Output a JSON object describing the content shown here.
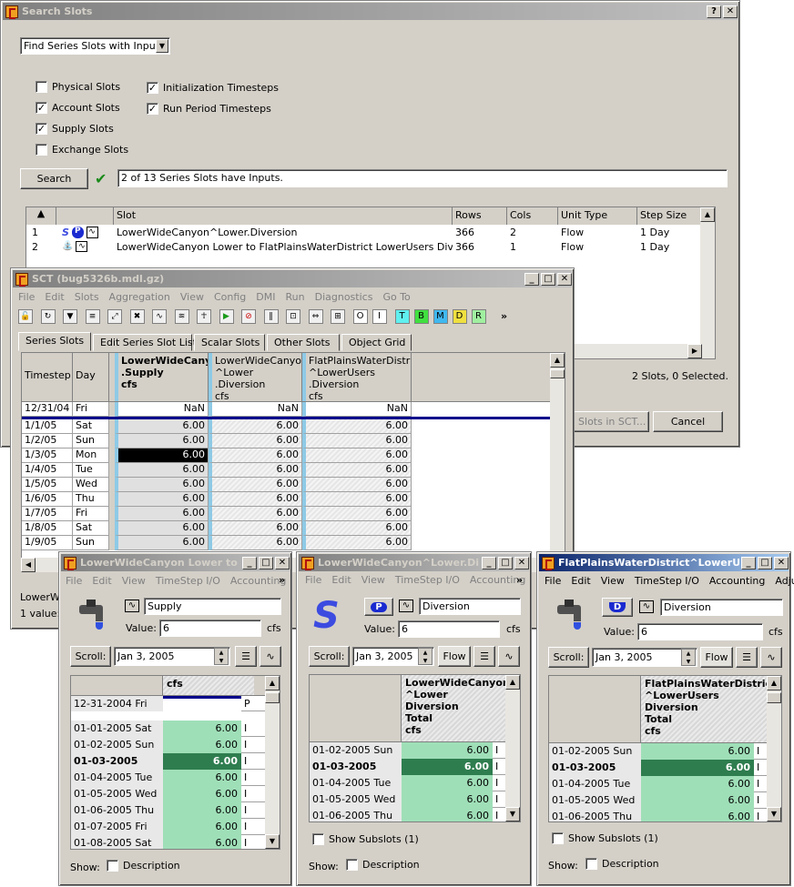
{
  "search": {
    "title": "Search Slots",
    "mode": "Find Series Slots with Inputs",
    "cb_left": [
      {
        "label": "Physical Slots",
        "checked": false
      },
      {
        "label": "Account Slots",
        "checked": true
      },
      {
        "label": "Supply Slots",
        "checked": true
      },
      {
        "label": "Exchange Slots",
        "checked": false
      }
    ],
    "cb_right": [
      {
        "label": "Initialization Timesteps",
        "checked": true
      },
      {
        "label": "Run Period Timesteps",
        "checked": true
      }
    ],
    "search_button": "Search",
    "status": "2 of 13 Series Slots have Inputs.",
    "cols": [
      "Slot",
      "Rows",
      "Cols",
      "Unit Type",
      "Step Size"
    ],
    "rows": [
      {
        "n": "1",
        "slot": "LowerWideCanyon^Lower.Diversion",
        "rows": "366",
        "cols": "2",
        "unit": "Flow",
        "step": "1 Day"
      },
      {
        "n": "2",
        "slot": "LowerWideCanyon Lower to FlatPlainsWaterDistrict LowerUsers Div.Supply",
        "rows": "366",
        "cols": "1",
        "unit": "Flow",
        "step": "1 Day"
      }
    ],
    "summary": "2 Slots, 0 Selected.",
    "open_button": "d Slots in SCT...",
    "cancel_button": "Cancel"
  },
  "sct": {
    "title": "SCT  (bug5326b.mdl.gz)",
    "menu": [
      "File",
      "Edit",
      "Slots",
      "Aggregation",
      "View",
      "Config",
      "DMI",
      "Run",
      "Diagnostics",
      "Go To"
    ],
    "tools": [
      "O",
      "I",
      "T",
      "B",
      "M",
      "D",
      "R"
    ],
    "tool_colors": {
      "T": "#5ff0f0",
      "B": "#40e040",
      "M": "#40b8f0",
      "D": "#f0e040",
      "R": "#a0f0a0"
    },
    "tabs": [
      "Series Slots",
      "Edit Series Slot List",
      "Scalar Slots",
      "Other Slots",
      "Object Grid"
    ],
    "h_ts": "Timestep",
    "h_day": "Day",
    "h_c1": "LowerWideCanyo\n.Supply\ncfs",
    "h_c2": "LowerWideCanyon\n^Lower\n.Diversion\ncfs",
    "h_c3": "FlatPlainsWaterDistrict\n^LowerUsers\n.Diversion\ncfs",
    "init": {
      "ts": "12/31/04",
      "day": "Fri",
      "v": [
        "NaN",
        "NaN",
        "NaN"
      ]
    },
    "rows": [
      {
        "ts": "1/1/05",
        "day": "Sat",
        "v": [
          "6.00",
          "6.00",
          "6.00"
        ]
      },
      {
        "ts": "1/2/05",
        "day": "Sun",
        "v": [
          "6.00",
          "6.00",
          "6.00"
        ]
      },
      {
        "ts": "1/3/05",
        "day": "Mon",
        "v": [
          "6.00",
          "6.00",
          "6.00"
        ]
      },
      {
        "ts": "1/4/05",
        "day": "Tue",
        "v": [
          "6.00",
          "6.00",
          "6.00"
        ]
      },
      {
        "ts": "1/5/05",
        "day": "Wed",
        "v": [
          "6.00",
          "6.00",
          "6.00"
        ]
      },
      {
        "ts": "1/6/05",
        "day": "Thu",
        "v": [
          "6.00",
          "6.00",
          "6.00"
        ]
      },
      {
        "ts": "1/7/05",
        "day": "Fri",
        "v": [
          "6.00",
          "6.00",
          "6.00"
        ]
      },
      {
        "ts": "1/8/05",
        "day": "Sat",
        "v": [
          "6.00",
          "6.00",
          "6.00"
        ]
      },
      {
        "ts": "1/9/05",
        "day": "Sun",
        "v": [
          "6.00",
          "6.00",
          "6.00"
        ]
      }
    ],
    "status1": "LowerWi",
    "status2": "1 value:"
  },
  "w1": {
    "title": "LowerWideCanyon Lower to F...",
    "menu": [
      "File",
      "Edit",
      "View",
      "TimeStep I/O",
      "Accounting"
    ],
    "name": "Supply",
    "value_label": "Value:",
    "value": "6",
    "unit": "cfs",
    "scroll": "Scroll:",
    "date": "Jan 3, 2005",
    "col": "cfs",
    "init": {
      "d": "12-31-2004 Fri",
      "f": "P"
    },
    "rows": [
      {
        "d": "01-01-2005 Sat",
        "v": "6.00",
        "f": "I"
      },
      {
        "d": "01-02-2005 Sun",
        "v": "6.00",
        "f": "I"
      },
      {
        "d": "01-03-2005 Mon",
        "v": "6.00",
        "f": "I"
      },
      {
        "d": "01-04-2005 Tue",
        "v": "6.00",
        "f": "I"
      },
      {
        "d": "01-05-2005 Wed",
        "v": "6.00",
        "f": "I"
      },
      {
        "d": "01-06-2005 Thu",
        "v": "6.00",
        "f": "I"
      },
      {
        "d": "01-07-2005 Fri",
        "v": "6.00",
        "f": "I"
      },
      {
        "d": "01-08-2005 Sat",
        "v": "6.00",
        "f": "I"
      }
    ],
    "show": "Show:",
    "desc": "Description"
  },
  "w2": {
    "title": "LowerWideCanyon^Lower.Di...",
    "menu": [
      "File",
      "Edit",
      "View",
      "TimeStep I/O",
      "Accounting"
    ],
    "badge": "P",
    "name": "Diversion",
    "value_label": "Value:",
    "value": "6",
    "unit": "cfs",
    "scroll": "Scroll:",
    "date": "Jan 3, 2005",
    "flow": "Flow",
    "col": "LowerWideCanyon\n^Lower\nDiversion\nTotal\ncfs",
    "rows": [
      {
        "d": "01-02-2005 Sun",
        "v": "6.00",
        "f": "I"
      },
      {
        "d": "01-03-2005 Mon",
        "v": "6.00",
        "f": "I"
      },
      {
        "d": "01-04-2005 Tue",
        "v": "6.00",
        "f": "I"
      },
      {
        "d": "01-05-2005 Wed",
        "v": "6.00",
        "f": "I"
      },
      {
        "d": "01-06-2005 Thu",
        "v": "6.00",
        "f": "I"
      }
    ],
    "subslots": "Show Subslots (1)",
    "show": "Show:",
    "desc": "Description"
  },
  "w3": {
    "title": "FlatPlainsWaterDistrict^LowerUs...",
    "menu": [
      "File",
      "Edit",
      "View",
      "TimeStep I/O",
      "Accounting",
      "Adjust"
    ],
    "badge": "D",
    "name": "Diversion",
    "value_label": "Value:",
    "value": "6",
    "unit": "cfs",
    "scroll": "Scroll:",
    "date": "Jan 3, 2005",
    "flow": "Flow",
    "col": "FlatPlainsWaterDistrict\n^LowerUsers\nDiversion\nTotal\ncfs",
    "rows": [
      {
        "d": "01-02-2005 Sun",
        "v": "6.00",
        "f": "I"
      },
      {
        "d": "01-03-2005 Mon",
        "v": "6.00",
        "f": "I"
      },
      {
        "d": "01-04-2005 Tue",
        "v": "6.00",
        "f": "I"
      },
      {
        "d": "01-05-2005 Wed",
        "v": "6.00",
        "f": "I"
      },
      {
        "d": "01-06-2005 Thu",
        "v": "6.00",
        "f": "I"
      }
    ],
    "subslots": "Show Subslots (1)",
    "show": "Show:",
    "desc": "Description"
  }
}
